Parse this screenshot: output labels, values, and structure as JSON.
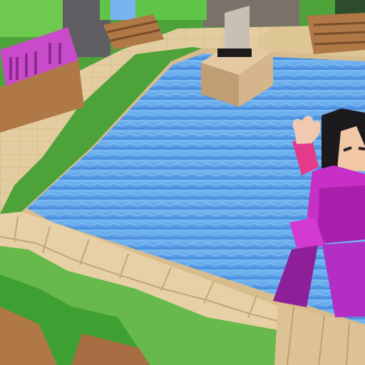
{
  "scene": {
    "type": "voxel-game-viewport",
    "hud_visible": false,
    "sign_text": ""
  },
  "colors": {
    "grass": "#4ea23a",
    "grass_light": "#79c64f",
    "sandstone": "#e3cda0",
    "sandstone_shadow": "#c9ac76",
    "water": "#5aa6ea",
    "water_deep": "#3f86d8",
    "wood": "#b07847",
    "wood_dark": "#7a4d2b",
    "magenta_block": "#c84cc9",
    "avatar_outfit": "#c72fc7",
    "avatar_outfit_dark": "#8e1f98",
    "avatar_skin": "#f1c7a5",
    "avatar_hair": "#1d1a1d"
  }
}
